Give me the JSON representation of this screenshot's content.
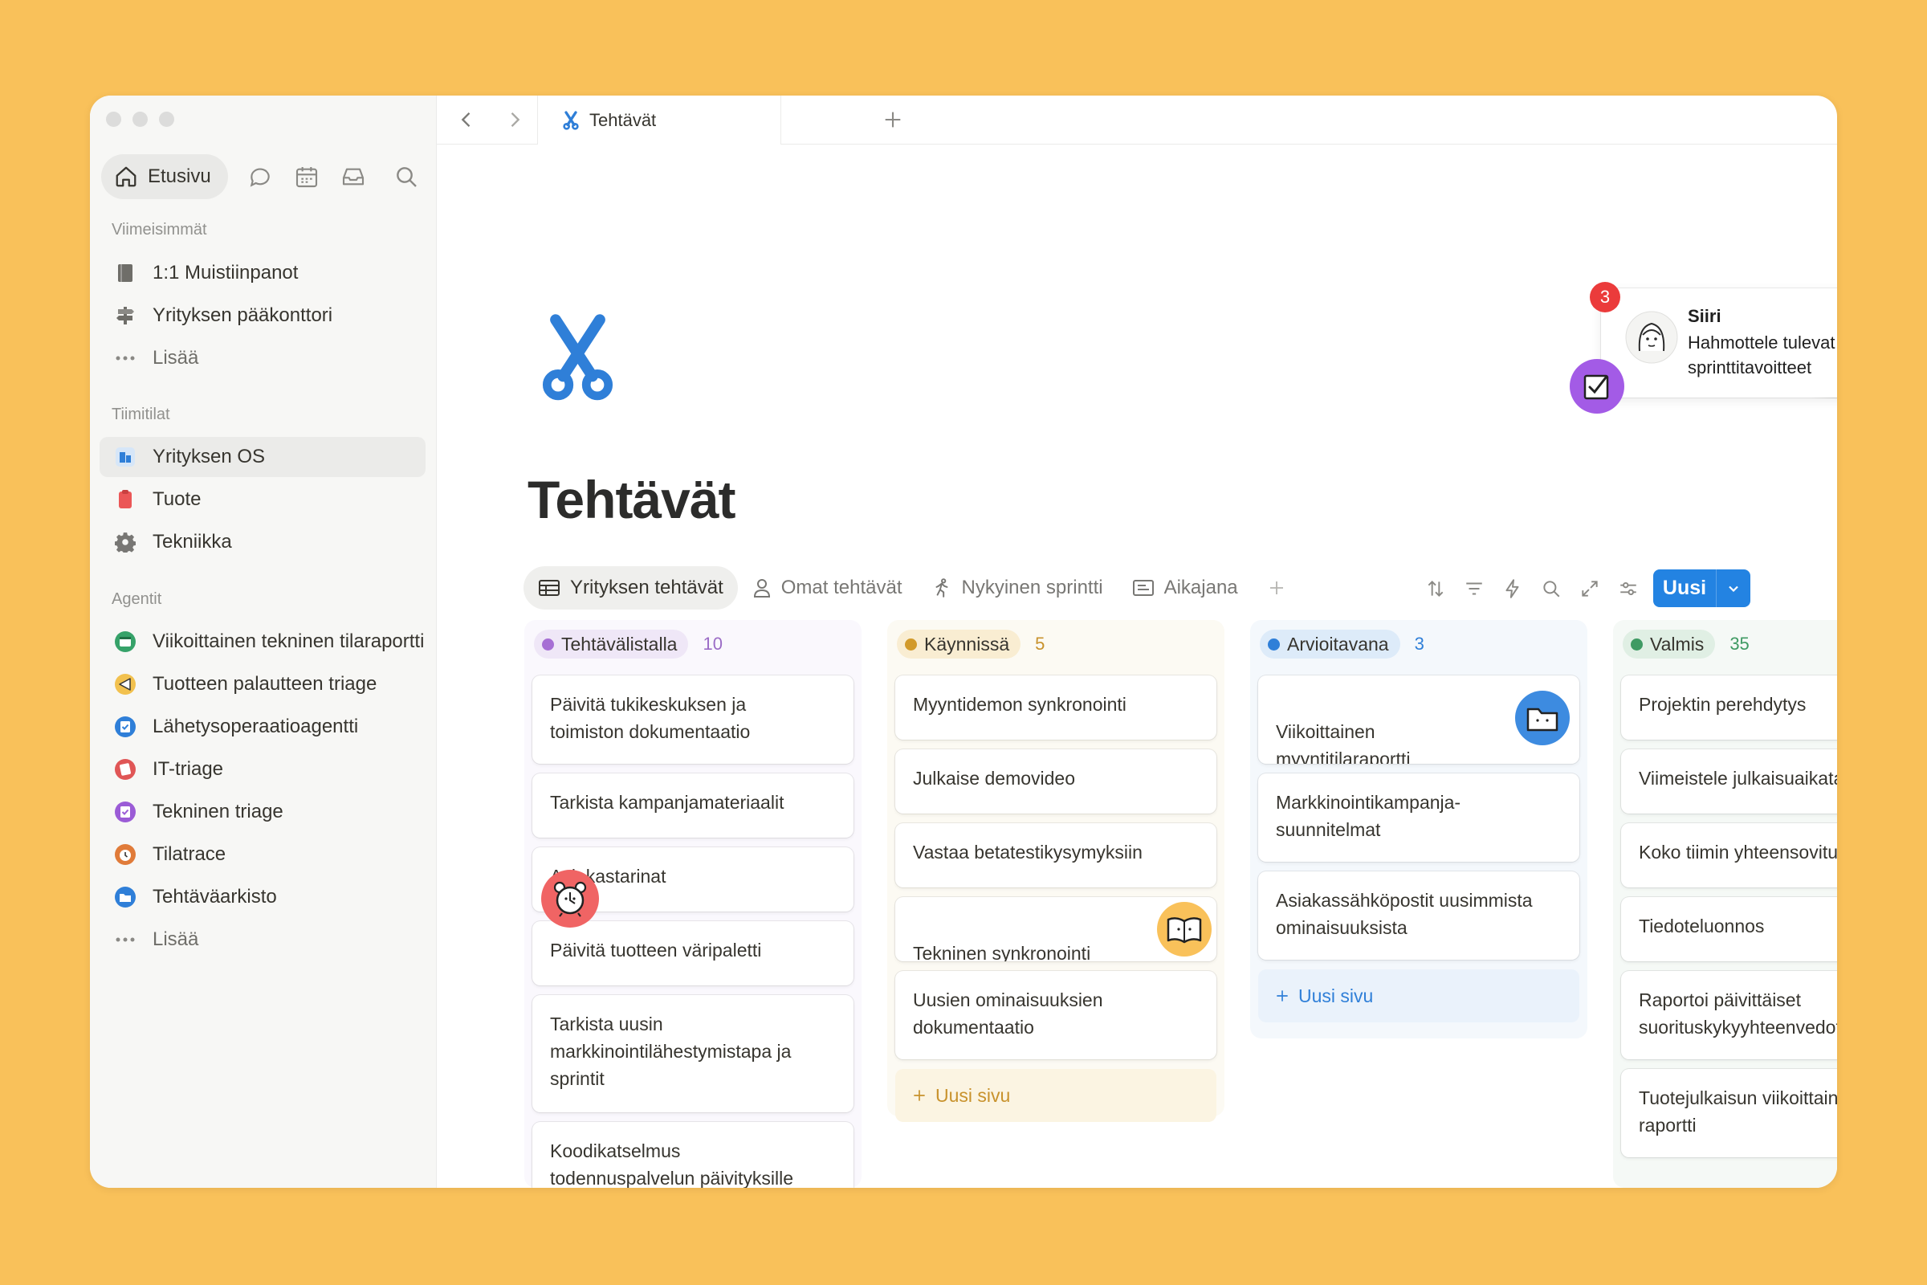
{
  "sidebar": {
    "home_label": "Etusivu",
    "sections": {
      "recent": "Viimeisimmät",
      "teamspaces": "Tiimitilat",
      "agents": "Agentit"
    },
    "recent_items": [
      {
        "label": "1:1 Muistiinpanot",
        "icon": "notebook-icon"
      },
      {
        "label": "Yrityksen pääkonttori",
        "icon": "signpost-icon"
      },
      {
        "label": "Lisää",
        "icon": "more-icon"
      }
    ],
    "team_items": [
      {
        "label": "Yrityksen OS",
        "icon": "building-icon",
        "color": "#2f7fd8"
      },
      {
        "label": "Tuote",
        "icon": "product-icon",
        "color": "#eb5757"
      },
      {
        "label": "Tekniikka",
        "icon": "gear-icon",
        "color": "#787774"
      }
    ],
    "agent_items": [
      {
        "label": "Viikoittainen tekninen tilaraportti",
        "icon": "calendar-agent-icon",
        "color": "#36a269"
      },
      {
        "label": "Tuotteen palautteen triage",
        "icon": "megaphone-agent-icon",
        "color": "#e0a528"
      },
      {
        "label": "Lähetysoperaatioagentti",
        "icon": "checklist-agent-icon",
        "color": "#2f7fd8"
      },
      {
        "label": "IT-triage",
        "icon": "lifebuoy-agent-icon",
        "color": "#e05656"
      },
      {
        "label": "Tekninen triage",
        "icon": "checklist-agent-icon",
        "color": "#9b5cd6"
      },
      {
        "label": "Tilatrace",
        "icon": "alarm-agent-icon",
        "color": "#e07b39"
      },
      {
        "label": "Tehtäväarkisto",
        "icon": "folder-agent-icon",
        "color": "#2f7fd8"
      },
      {
        "label": "Lisää",
        "icon": "more-icon"
      }
    ]
  },
  "tab": {
    "title": "Tehtävät",
    "icon": "scissors-icon"
  },
  "page": {
    "title": "Tehtävät",
    "icon": "scissors-icon",
    "accent": "#2f7fd8"
  },
  "views": [
    {
      "label": "Yrityksen tehtävät",
      "icon": "table-icon",
      "active": true
    },
    {
      "label": "Omat tehtävät",
      "icon": "person-icon"
    },
    {
      "label": "Nykyinen sprintti",
      "icon": "running-icon"
    },
    {
      "label": "Aikajana",
      "icon": "timeline-icon"
    }
  ],
  "toolbar": {
    "new_label": "Uusi",
    "new_color": "#2383e2"
  },
  "notification": {
    "count": "3",
    "name": "Siiri",
    "message": "Hahmottele tulevat sprinttitavoitteet"
  },
  "board": {
    "add_label": "Uusi sivu",
    "columns": [
      {
        "name": "Tehtävälistalla",
        "count": "10",
        "dot": "#a66fd4",
        "pill_bg": "#efe7f7",
        "count_color": "#9b6cc6",
        "bg": "#faf8fd",
        "cards": [
          "Päivitä tukikeskuksen ja\ntoimiston dokumentaatio",
          "Tarkista kampanjamateriaalit",
          "Asiakastarinat",
          "Päivitä tuotteen väripaletti",
          "Tarkista uusin\nmarkkinointilähestymistapa ja\nsprintit",
          "Koodikatselmus\ntodennuspalvelun päivityksille"
        ]
      },
      {
        "name": "Käynnissä",
        "count": "5",
        "dot": "#d29a2a",
        "pill_bg": "#f9edd2",
        "count_color": "#c8922c",
        "bg": "#fcfaf3",
        "cards": [
          "Myyntidemon synkronointi",
          "Julkaise demovideo",
          "Vastaa betatestikysymyksiin",
          "Tekninen synkronointi",
          "Uusien ominaisuuksien\ndokumentaatio"
        ]
      },
      {
        "name": "Arvioitavana",
        "count": "3",
        "dot": "#2f7fd8",
        "pill_bg": "#ddebf9",
        "count_color": "#2f7fd8",
        "bg": "#f4f8fc",
        "cards": [
          "Viikoittainen\nmyyntitilaraportti",
          "Markkinointikampanja-\nsuunnitelmat",
          "Asiakassähköpostit uusimmista\nominaisuuksista"
        ]
      },
      {
        "name": "Valmis",
        "count": "35",
        "dot": "#3f9a63",
        "pill_bg": "#e0efe4",
        "count_color": "#3f9a63",
        "bg": "#f5f9f6",
        "cards": [
          "Projektin perehdytys",
          "Viimeistele julkaisuaikataulu",
          "Koko tiimin yhteensovitus",
          "Tiedoteluonnos",
          "Raportoi päivittäiset\nsuorituskykyyhteenvedot",
          "Tuotejulkaisun viikoittainen\nraportti"
        ]
      }
    ]
  }
}
